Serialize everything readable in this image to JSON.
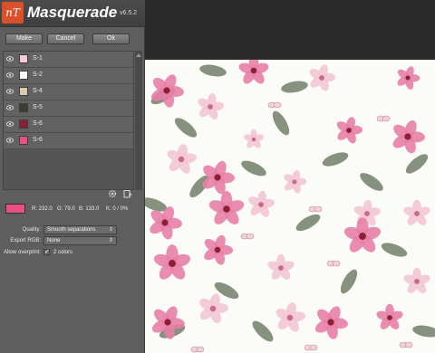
{
  "app": {
    "logo_text": "nT",
    "title": "Masquerade",
    "version": "v6.5.2"
  },
  "toolbar": {
    "make_label": "Make",
    "cancel_label": "Cancel",
    "ok_label": "Ok"
  },
  "separations": [
    {
      "name": "S-1",
      "color": "#f6c9d6"
    },
    {
      "name": "S-2",
      "color": "#fbfaf7"
    },
    {
      "name": "S-4",
      "color": "#d8ccb2"
    },
    {
      "name": "S-5",
      "color": "#3b3f2e"
    },
    {
      "name": "S-6",
      "color": "#8b1f33"
    },
    {
      "name": "S-6",
      "color": "#e84f85"
    }
  ],
  "icons": [
    "eye-icon",
    "gear-icon",
    "new-separation-icon",
    "scroll-arrow-icon"
  ],
  "selected": {
    "color": "#e84f85",
    "r": "R: 232.0",
    "g": "G: 79.0",
    "b": "B: 133.0",
    "k": "K: 0 / 0%"
  },
  "options": {
    "quality_label": "Quality:",
    "quality_value": "Smooth separations",
    "export_label": "Export RGB:",
    "export_value": "None",
    "overprint_label": "Allow overprint:",
    "overprint_checked": true,
    "overprint_value": "2 colors"
  },
  "colors": {
    "panel_bg": "#5e5e5e",
    "logo_bg": "#d9502a",
    "canvas_bg": "#fbfbf8",
    "orchid_pink": "#e77fa6",
    "orchid_light": "#f3c7d5",
    "leaf": "#5f6e55",
    "throat": "#8b1f33"
  }
}
